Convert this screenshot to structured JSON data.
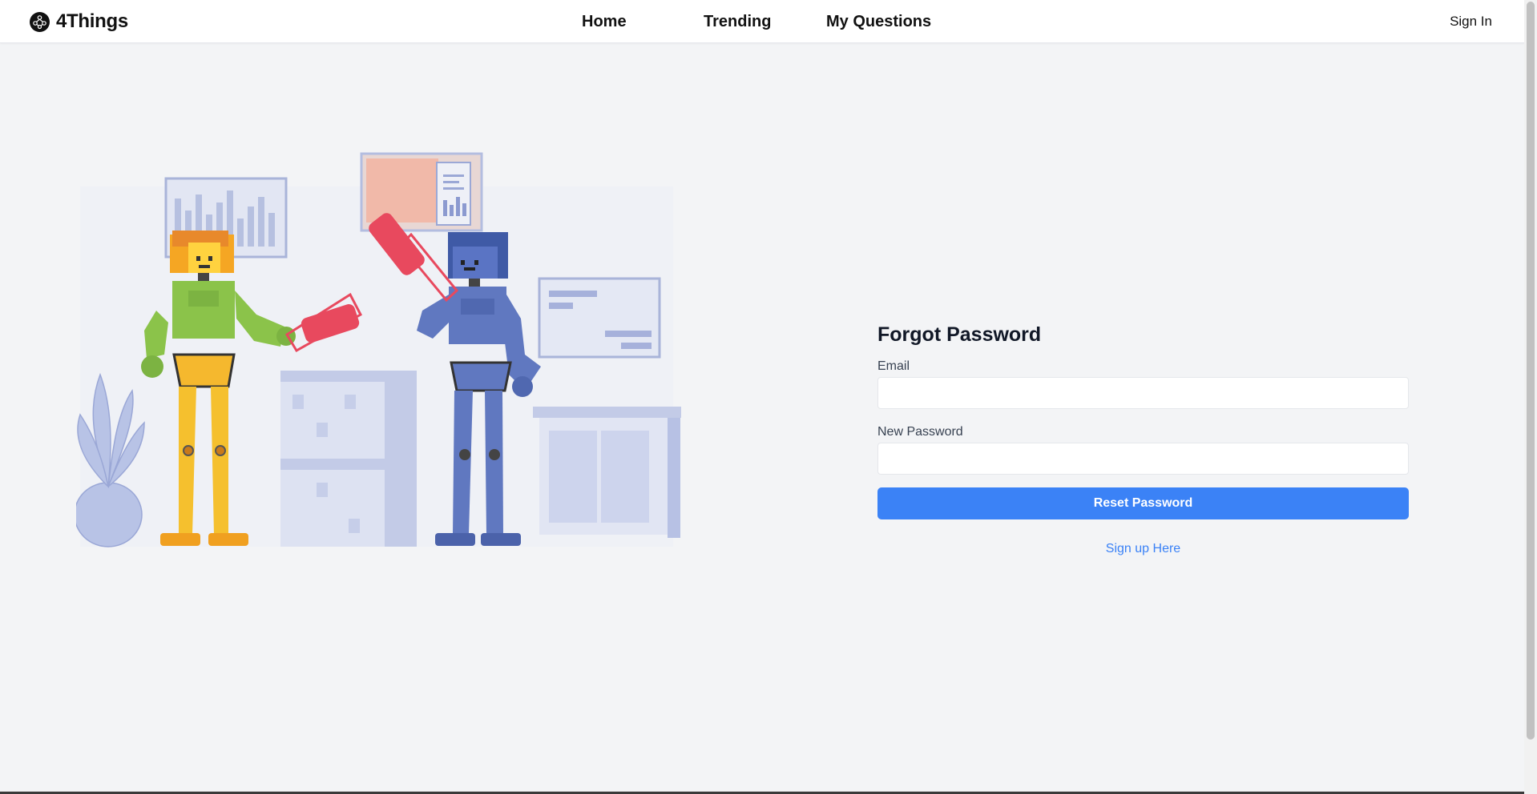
{
  "nav": {
    "brand": "4Things",
    "links": [
      "Home",
      "Trending",
      "My Questions"
    ],
    "sign_in": "Sign In"
  },
  "form": {
    "title": "Forgot Password",
    "email_label": "Email",
    "email_value": "",
    "password_label": "New Password",
    "password_value": "",
    "submit_label": "Reset Password",
    "signup_link": "Sign up Here"
  },
  "colors": {
    "accent": "#3b82f6",
    "background": "#f3f4f6",
    "robot_green": "#8bc34a",
    "robot_yellow": "#f5b82e",
    "robot_blue": "#6078c0",
    "telescope_red": "#e8495e"
  },
  "icons": {
    "brand": "network-logo-icon",
    "illustration": "robots-with-telescope-illustration"
  }
}
